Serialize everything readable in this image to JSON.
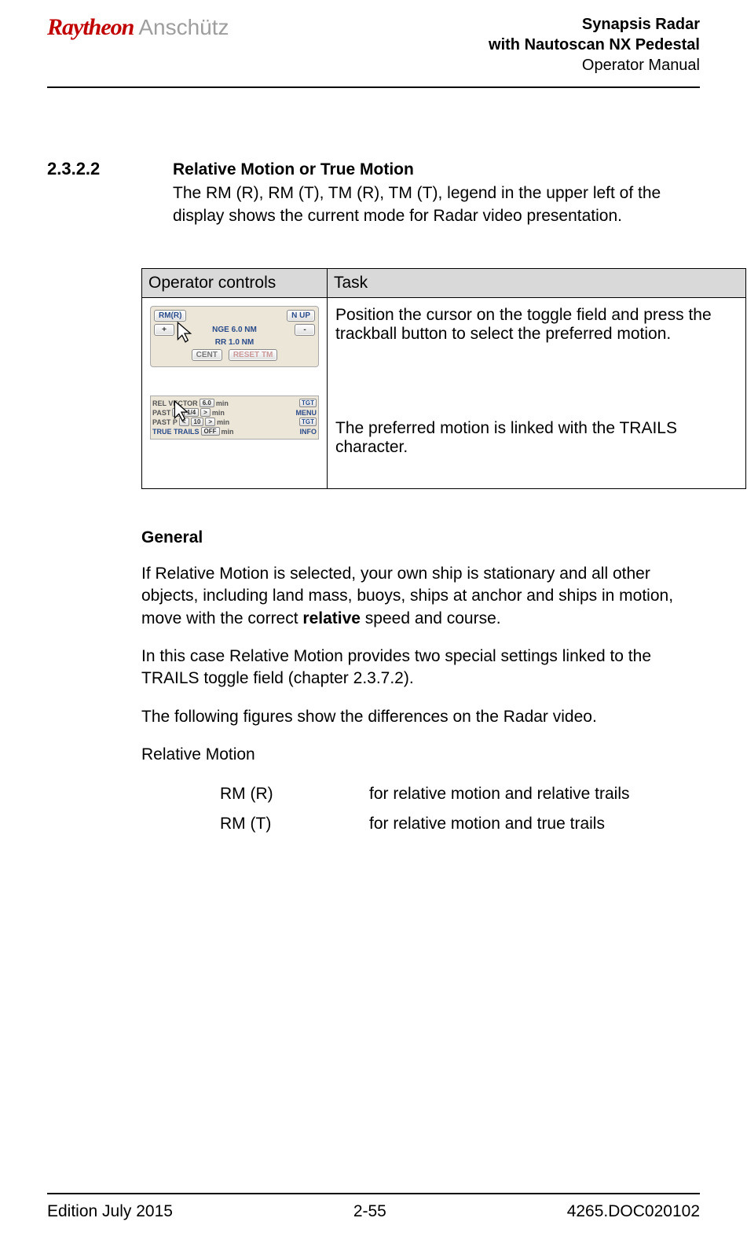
{
  "header": {
    "logo_primary": "Raytheon",
    "logo_secondary": "Anschütz",
    "title_line1": "Synapsis Radar",
    "title_line2": "with Nautoscan NX Pedestal",
    "title_line3": "Operator Manual"
  },
  "section": {
    "number": "2.3.2.2",
    "title": "Relative Motion or True Motion",
    "intro": "The RM (R), RM (T), TM (R), TM (T), legend in the upper left of the display shows the current mode for Radar video presentation."
  },
  "table": {
    "headers": {
      "col1": "Operator controls",
      "col2": "Task"
    },
    "row1": {
      "task_p1": "Position the cursor on the toggle field and press the trackball button to select the preferred motion.",
      "task_p2": "The preferred motion is linked with the TRAILS character."
    },
    "widget1": {
      "rm_btn": "RM(R)",
      "nup_btn": "N UP",
      "plus": "+",
      "range": "NGE 6.0 NM",
      "minus": "-",
      "rr": "RR 1.0 NM",
      "cent": "CENT",
      "reset": "RESET TM"
    },
    "widget2": {
      "r1_label": "REL VECTOR",
      "r1_val": "6.0",
      "r1_unit": "min",
      "r1_side": "TGT",
      "r2_label": "PAST",
      "r2_val": "1/4",
      "r2_unit": "min",
      "r2_side": "MENU",
      "r3_label": "PAST P",
      "r3_val": "10",
      "r3_unit": "min",
      "r3_side": "TGT",
      "r4_label": "TRUE TRAILS",
      "r4_val": "OFF",
      "r4_unit": "min",
      "r4_side": "INFO"
    }
  },
  "general": {
    "heading": "General",
    "p1_pre": "If Relative Motion is selected, your own ship is stationary and all other objects, including land mass, buoys, ships at anchor and ships in motion, move with the correct ",
    "p1_bold": "relative",
    "p1_post": " speed and course.",
    "p2": "In this case Relative Motion provides two special settings linked to the TRAILS toggle field (chapter 2.3.7.2).",
    "p3": "The following figures show the differences on the Radar video.",
    "p4": "Relative Motion",
    "defs": [
      {
        "term": "RM (R)",
        "desc": "for relative motion and relative trails"
      },
      {
        "term": "RM (T)",
        "desc": "for relative motion and true trails"
      }
    ]
  },
  "footer": {
    "left": "Edition July 2015",
    "center": "2-55",
    "right": "4265.DOC020102"
  }
}
